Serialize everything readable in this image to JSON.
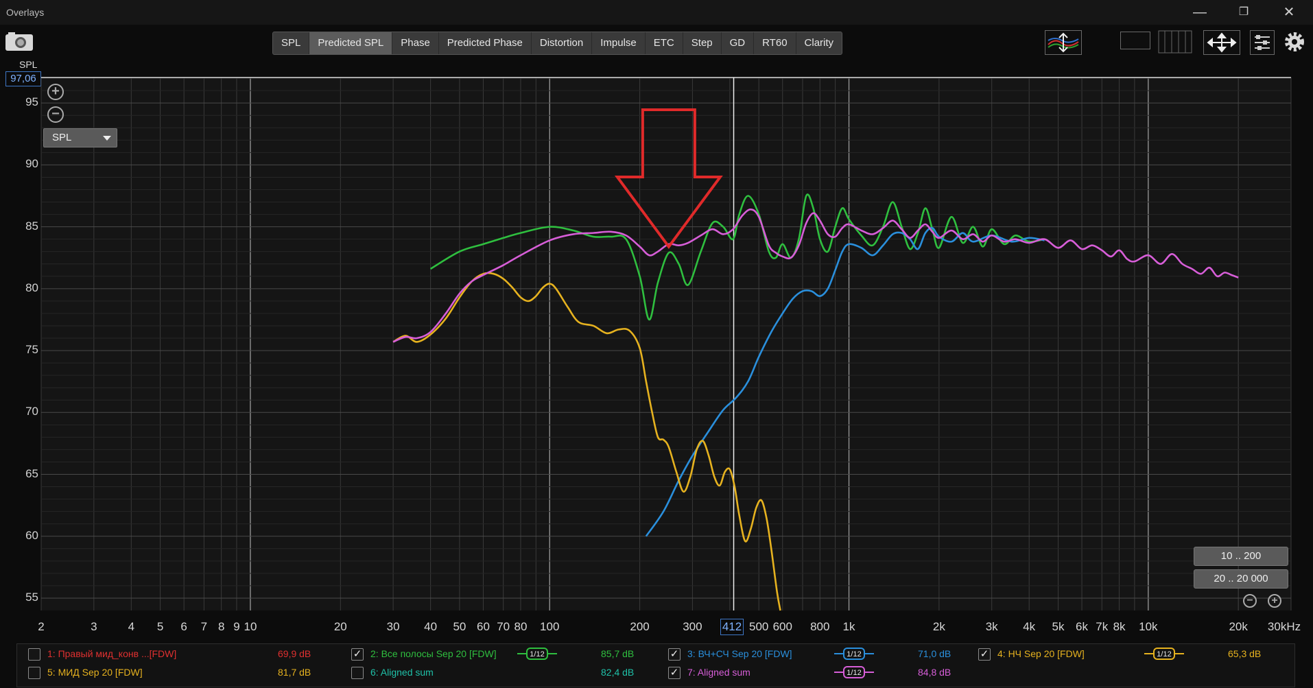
{
  "window": {
    "title": "Overlays",
    "minimize_icon": "minimize-icon",
    "restore_icon": "restore-icon",
    "close_icon": "close-icon"
  },
  "toolbar": {
    "tabs": [
      "SPL",
      "Predicted SPL",
      "Phase",
      "Predicted Phase",
      "Distortion",
      "Impulse",
      "ETC",
      "Step",
      "GD",
      "RT60",
      "Clarity"
    ],
    "active_tab": "Predicted SPL"
  },
  "axis": {
    "y_label": "SPL",
    "y_top_value": "97,06",
    "y_ticks": [
      "95",
      "90",
      "85",
      "80",
      "75",
      "70",
      "65",
      "60",
      "55"
    ],
    "x_ticks": [
      "2",
      "3",
      "4",
      "5",
      "6",
      "7",
      "8",
      "9",
      "10",
      "20",
      "30",
      "40",
      "50",
      "60",
      "70",
      "80",
      "100",
      "200",
      "300",
      "500",
      "600",
      "800",
      "1k",
      "2k",
      "3k",
      "4k",
      "5k",
      "6k",
      "7k",
      "8k",
      "10k",
      "20k",
      "30kHz"
    ],
    "cursor_value": "412"
  },
  "controls": {
    "dropdown_value": "SPL",
    "range_btn_1": "10 .. 200",
    "range_btn_2": "20 .. 20 000"
  },
  "colors": {
    "green": "#2fbf3f",
    "blue": "#2a8fdc",
    "magenta": "#d75ed8",
    "yellow": "#e6b21f",
    "red": "#e03030",
    "teal": "#1fc0a8"
  },
  "legend": [
    {
      "label": "1: Правый мид_конв ...[FDW]",
      "value": "69,9 dB",
      "checked": false,
      "color": "#e03030",
      "smoothing": ""
    },
    {
      "label": "2: Все полосы Sep 20 [FDW]",
      "value": "85,7 dB",
      "checked": true,
      "color": "#2fbf3f",
      "smoothing": "1/12"
    },
    {
      "label": "3: ВЧ+СЧ Sep 20 [FDW]",
      "value": "71,0 dB",
      "checked": true,
      "color": "#2a8fdc",
      "smoothing": "1/12"
    },
    {
      "label": "4: НЧ Sep 20 [FDW]",
      "value": "65,3 dB",
      "checked": true,
      "color": "#e6b21f",
      "smoothing": "1/12"
    },
    {
      "label": "5: МИД Sep 20 [FDW]",
      "value": "81,7 dB",
      "checked": false,
      "color": "#e6b21f",
      "smoothing": ""
    },
    {
      "label": "6: Aligned sum",
      "value": "82,4 dB",
      "checked": false,
      "color": "#1fc0a8",
      "smoothing": ""
    },
    {
      "label": "7: Aligned sum",
      "value": "84,8 dB",
      "checked": true,
      "color": "#d75ed8",
      "smoothing": "1/12"
    }
  ],
  "chart_data": {
    "type": "line",
    "xscale": "log",
    "xlim": [
      2,
      30000
    ],
    "ylim": [
      54,
      97.06
    ],
    "cursor_x": 412,
    "grid": true,
    "annotation": "red-down-arrow-at-250Hz",
    "series": [
      {
        "name": "2: Все полосы Sep 20 [FDW]",
        "color": "#2fbf3f",
        "points": [
          [
            40,
            81.6
          ],
          [
            50,
            83
          ],
          [
            60,
            83.6
          ],
          [
            70,
            84.1
          ],
          [
            80,
            84.5
          ],
          [
            100,
            85
          ],
          [
            120,
            84.7
          ],
          [
            140,
            84.2
          ],
          [
            160,
            84.2
          ],
          [
            180,
            84
          ],
          [
            200,
            81
          ],
          [
            215,
            77.5
          ],
          [
            230,
            80.5
          ],
          [
            250,
            82.9
          ],
          [
            270,
            82
          ],
          [
            290,
            80.3
          ],
          [
            320,
            83
          ],
          [
            350,
            85.3
          ],
          [
            380,
            85
          ],
          [
            410,
            84
          ],
          [
            430,
            86
          ],
          [
            460,
            87.5
          ],
          [
            500,
            86
          ],
          [
            540,
            83
          ],
          [
            570,
            82.5
          ],
          [
            600,
            83.6
          ],
          [
            640,
            82.5
          ],
          [
            680,
            84
          ],
          [
            720,
            87.5
          ],
          [
            760,
            86.5
          ],
          [
            800,
            84
          ],
          [
            850,
            83
          ],
          [
            900,
            85
          ],
          [
            950,
            86.5
          ],
          [
            1000,
            85.6
          ],
          [
            1100,
            84.3
          ],
          [
            1200,
            83.5
          ],
          [
            1300,
            85
          ],
          [
            1400,
            87
          ],
          [
            1500,
            85
          ],
          [
            1600,
            83.2
          ],
          [
            1700,
            84.5
          ],
          [
            1800,
            86.5
          ],
          [
            1900,
            84.8
          ],
          [
            2000,
            83.3
          ],
          [
            2200,
            85.8
          ],
          [
            2400,
            83.7
          ],
          [
            2600,
            85
          ],
          [
            2800,
            83.4
          ],
          [
            3000,
            84.8
          ],
          [
            3300,
            83.6
          ],
          [
            3600,
            84.3
          ],
          [
            4000,
            83.8
          ],
          [
            4500,
            84
          ]
        ]
      },
      {
        "name": "3: ВЧ+СЧ Sep 20 [FDW]",
        "color": "#2a8fdc",
        "points": [
          [
            210,
            60
          ],
          [
            240,
            62
          ],
          [
            270,
            64.5
          ],
          [
            300,
            66.5
          ],
          [
            340,
            68.5
          ],
          [
            380,
            70.2
          ],
          [
            420,
            71.2
          ],
          [
            460,
            72.5
          ],
          [
            500,
            74.5
          ],
          [
            550,
            76.5
          ],
          [
            600,
            78
          ],
          [
            650,
            79.2
          ],
          [
            700,
            79.8
          ],
          [
            750,
            79.8
          ],
          [
            800,
            79.4
          ],
          [
            850,
            80
          ],
          [
            900,
            81.5
          ],
          [
            950,
            83
          ],
          [
            1000,
            83.6
          ],
          [
            1100,
            83.3
          ],
          [
            1200,
            82.7
          ],
          [
            1300,
            83.5
          ],
          [
            1400,
            84.4
          ],
          [
            1500,
            84.5
          ],
          [
            1600,
            84
          ],
          [
            1700,
            83.2
          ],
          [
            1800,
            84.5
          ],
          [
            1900,
            84.9
          ],
          [
            2000,
            84.2
          ],
          [
            2200,
            83.8
          ],
          [
            2400,
            84.5
          ],
          [
            2600,
            83.8
          ],
          [
            3000,
            84.3
          ],
          [
            3500,
            83.8
          ],
          [
            4000,
            84.1
          ],
          [
            4500,
            83.9
          ]
        ]
      },
      {
        "name": "4: НЧ Sep 20 [FDW]",
        "color": "#e6b21f",
        "points": [
          [
            30,
            75.7
          ],
          [
            33,
            76.2
          ],
          [
            36,
            75.7
          ],
          [
            40,
            76.3
          ],
          [
            45,
            77.6
          ],
          [
            50,
            79.3
          ],
          [
            55,
            80.6
          ],
          [
            60,
            81.2
          ],
          [
            65,
            81.2
          ],
          [
            70,
            80.8
          ],
          [
            75,
            80.1
          ],
          [
            80,
            79.3
          ],
          [
            85,
            79
          ],
          [
            90,
            79.4
          ],
          [
            95,
            80.1
          ],
          [
            100,
            80.4
          ],
          [
            105,
            80
          ],
          [
            115,
            78.5
          ],
          [
            125,
            77.3
          ],
          [
            140,
            77
          ],
          [
            155,
            76.4
          ],
          [
            170,
            76.7
          ],
          [
            185,
            76.6
          ],
          [
            200,
            75.2
          ],
          [
            210,
            72.5
          ],
          [
            220,
            70
          ],
          [
            230,
            68
          ],
          [
            240,
            67.8
          ],
          [
            250,
            67.2
          ],
          [
            265,
            65.2
          ],
          [
            280,
            63.6
          ],
          [
            295,
            64.8
          ],
          [
            310,
            67
          ],
          [
            325,
            67.7
          ],
          [
            340,
            66.5
          ],
          [
            355,
            64.8
          ],
          [
            370,
            64.1
          ],
          [
            385,
            65.2
          ],
          [
            400,
            65.4
          ],
          [
            415,
            64
          ],
          [
            430,
            61.7
          ],
          [
            450,
            59.6
          ],
          [
            470,
            60.6
          ],
          [
            490,
            62.3
          ],
          [
            510,
            62.9
          ],
          [
            530,
            61.5
          ],
          [
            550,
            59
          ],
          [
            575,
            55.5
          ],
          [
            590,
            54
          ]
        ]
      },
      {
        "name": "7: Aligned sum",
        "color": "#d75ed8",
        "points": [
          [
            30,
            75.7
          ],
          [
            33,
            76.1
          ],
          [
            36,
            76
          ],
          [
            40,
            76.5
          ],
          [
            45,
            78
          ],
          [
            50,
            79.6
          ],
          [
            55,
            80.6
          ],
          [
            60,
            81.1
          ],
          [
            70,
            81.9
          ],
          [
            80,
            82.7
          ],
          [
            100,
            83.9
          ],
          [
            120,
            84.4
          ],
          [
            140,
            84.5
          ],
          [
            160,
            84.6
          ],
          [
            180,
            84.3
          ],
          [
            200,
            83.4
          ],
          [
            215,
            82.7
          ],
          [
            230,
            83
          ],
          [
            250,
            83.6
          ],
          [
            270,
            83.5
          ],
          [
            290,
            83.7
          ],
          [
            320,
            84.3
          ],
          [
            350,
            84.8
          ],
          [
            380,
            84.4
          ],
          [
            410,
            84.8
          ],
          [
            440,
            85.9
          ],
          [
            470,
            86.4
          ],
          [
            500,
            85.8
          ],
          [
            540,
            83.5
          ],
          [
            570,
            82.9
          ],
          [
            600,
            82.6
          ],
          [
            640,
            82.5
          ],
          [
            680,
            83.5
          ],
          [
            720,
            85.3
          ],
          [
            760,
            86.1
          ],
          [
            800,
            85.5
          ],
          [
            850,
            84.4
          ],
          [
            900,
            84.2
          ],
          [
            950,
            84.9
          ],
          [
            1000,
            85.2
          ],
          [
            1100,
            84.7
          ],
          [
            1200,
            84.4
          ],
          [
            1300,
            84.9
          ],
          [
            1400,
            85.5
          ],
          [
            1500,
            84.8
          ],
          [
            1600,
            84.1
          ],
          [
            1700,
            84.7
          ],
          [
            1800,
            85.2
          ],
          [
            1900,
            84.6
          ],
          [
            2000,
            84.1
          ],
          [
            2200,
            84.7
          ],
          [
            2400,
            84
          ],
          [
            2600,
            84.4
          ],
          [
            2800,
            83.8
          ],
          [
            3000,
            84.3
          ],
          [
            3300,
            83.8
          ],
          [
            3600,
            84
          ],
          [
            4000,
            83.7
          ],
          [
            4500,
            84
          ],
          [
            5000,
            83.3
          ],
          [
            5500,
            83.9
          ],
          [
            6000,
            83.2
          ],
          [
            6500,
            83.5
          ],
          [
            7000,
            83.1
          ],
          [
            7500,
            82.6
          ],
          [
            8000,
            83.1
          ],
          [
            8500,
            82.4
          ],
          [
            9000,
            82.2
          ],
          [
            10000,
            82.7
          ],
          [
            11000,
            82
          ],
          [
            12000,
            82.8
          ],
          [
            13000,
            82
          ],
          [
            14000,
            81.6
          ],
          [
            15000,
            81.2
          ],
          [
            16000,
            81.7
          ],
          [
            17000,
            81
          ],
          [
            18000,
            81.3
          ],
          [
            19000,
            81.1
          ],
          [
            20000,
            80.9
          ]
        ]
      }
    ]
  }
}
